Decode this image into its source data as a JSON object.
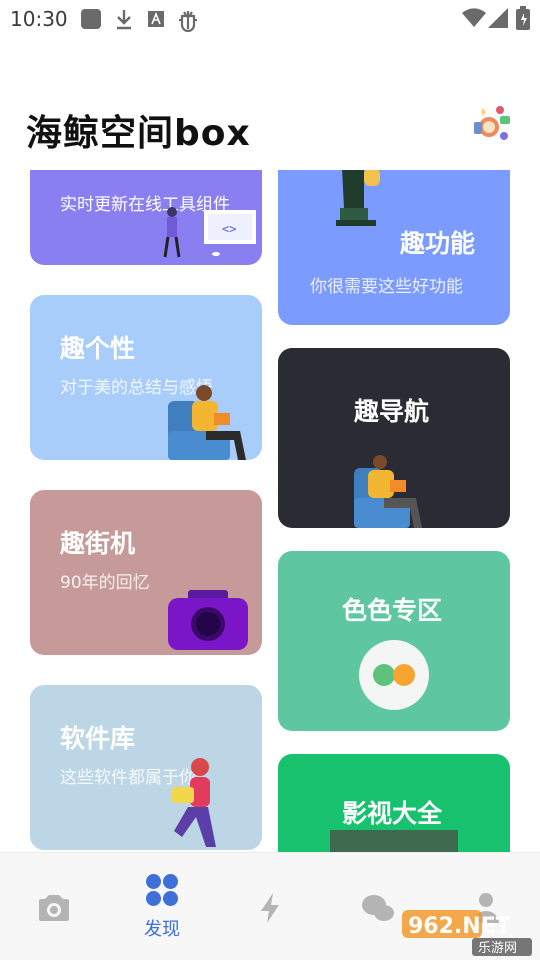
{
  "status_bar": {
    "time": "10:30"
  },
  "header": {
    "title": "海鲸空间box"
  },
  "cards": {
    "tools": {
      "subtitle": "实时更新在线工具组件",
      "color": "#8a7ff0"
    },
    "fun": {
      "title": "趣功能",
      "subtitle": "你很需要这些好功能",
      "color": "#7c9bff"
    },
    "persona": {
      "title": "趣个性",
      "subtitle": "对于美的总结与感悟",
      "color": "#a9cdfb"
    },
    "nav": {
      "title": "趣导航",
      "color": "#2b2b34"
    },
    "arcade": {
      "title": "趣街机",
      "subtitle": "90年的回忆",
      "color": "#c59a98"
    },
    "color": {
      "title": "色色专区",
      "color": "#5ec6a0"
    },
    "software": {
      "title": "软件库",
      "subtitle": "这些软件都属于你",
      "color": "#bdd6e6"
    },
    "video": {
      "title": "影视大全",
      "color": "#17c16e"
    }
  },
  "bottom_nav": {
    "accent": "#3f6fd8",
    "items": [
      {
        "icon": "camera-icon"
      },
      {
        "icon": "grid-icon",
        "label": "发现",
        "active": true
      },
      {
        "icon": "lightning-icon"
      },
      {
        "icon": "chat-icon"
      },
      {
        "icon": "user-icon"
      }
    ]
  },
  "watermark": {
    "text": "962.NET",
    "subtext": "乐游网"
  }
}
